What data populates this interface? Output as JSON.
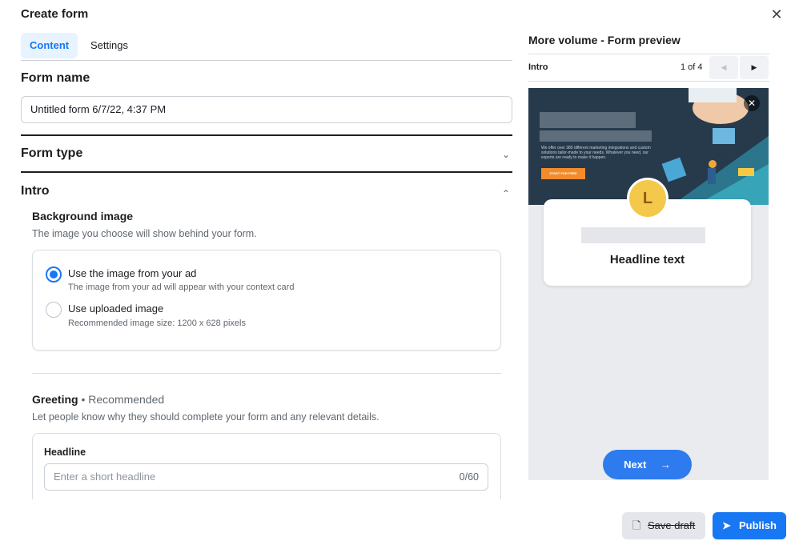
{
  "modal": {
    "title": "Create form"
  },
  "tabs": [
    {
      "label": "Content",
      "active": true
    },
    {
      "label": "Settings",
      "active": false
    }
  ],
  "form_name": {
    "label": "Form name",
    "value": "Untitled form 6/7/22, 4:37 PM"
  },
  "form_type": {
    "label": "Form type"
  },
  "intro": {
    "label": "Intro",
    "background": {
      "heading": "Background image",
      "description": "The image you choose will show behind your form.",
      "options": [
        {
          "title": "Use the image from your ad",
          "description": "The image from your ad will appear with your context card",
          "checked": true
        },
        {
          "title": "Use uploaded image",
          "description": "Recommended image size: 1200 x 628 pixels",
          "checked": false
        }
      ]
    },
    "greeting": {
      "heading": "Greeting",
      "recommended": " • Recommended",
      "description": "Let people know why they should complete your form and any relevant details.",
      "headline_label": "Headline",
      "headline_placeholder": "Enter a short headline",
      "headline_count": "0/60"
    }
  },
  "preview": {
    "title": "More volume - Form preview",
    "section": "Intro",
    "page_indicator": "1 of 4",
    "hero_text": "We offer over 380 different marketing integrations and custom solutions tailor-made to your needs. Whatever you need, our experts are ready to make it happen.",
    "hero_button": "START FOR FREE",
    "avatar_letter": "L",
    "headline": "Headline text",
    "next_label": "Next"
  },
  "footer": {
    "save_label": "Save draft",
    "publish_label": "Publish"
  },
  "colors": {
    "accent": "#1877f2",
    "next_button": "#2d7bee",
    "hero_bg": "#263a4c",
    "avatar": "#f3c84b"
  }
}
